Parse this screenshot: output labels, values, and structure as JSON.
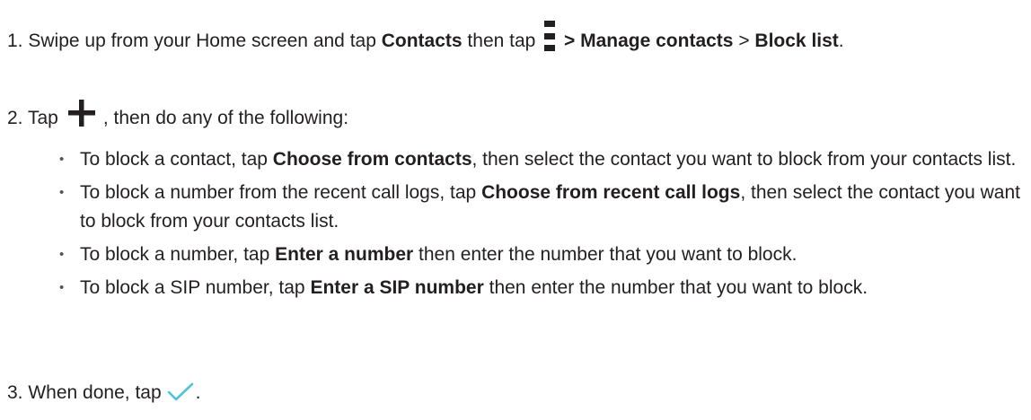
{
  "steps": [
    {
      "number": "1.",
      "parts": [
        "Swipe up from your Home screen and tap ",
        "Contacts",
        " then tap ",
        " > Manage contacts",
        " > ",
        "Block list",
        "."
      ],
      "icon": "menu-icon"
    },
    {
      "number": "2.",
      "before": "Tap",
      "after": ", then do any of the following:",
      "icon": "plus-icon"
    },
    {
      "number": "3.",
      "before": "When done, tap",
      "after": ".",
      "icon": "check-icon"
    }
  ],
  "bullets": [
    {
      "pre": "To block a contact, tap ",
      "bold": "Choose from contacts",
      "post": ", then select the contact you want to block from your contacts list."
    },
    {
      "pre": "To block a number from the recent call logs, tap ",
      "bold": "Choose from recent call logs",
      "post": ", then select the contact you want to block from your contacts list."
    },
    {
      "pre": "To block a number, tap ",
      "bold": "Enter a number",
      "post": " then enter the number that you want to block."
    },
    {
      "pre": "To block a SIP number, tap ",
      "bold": "Enter a SIP number",
      "post": " then enter the number that you want to block."
    }
  ],
  "bullet_glyph": "•",
  "colors": {
    "text": "#231f20",
    "check_accent": "#4fc3d9"
  }
}
